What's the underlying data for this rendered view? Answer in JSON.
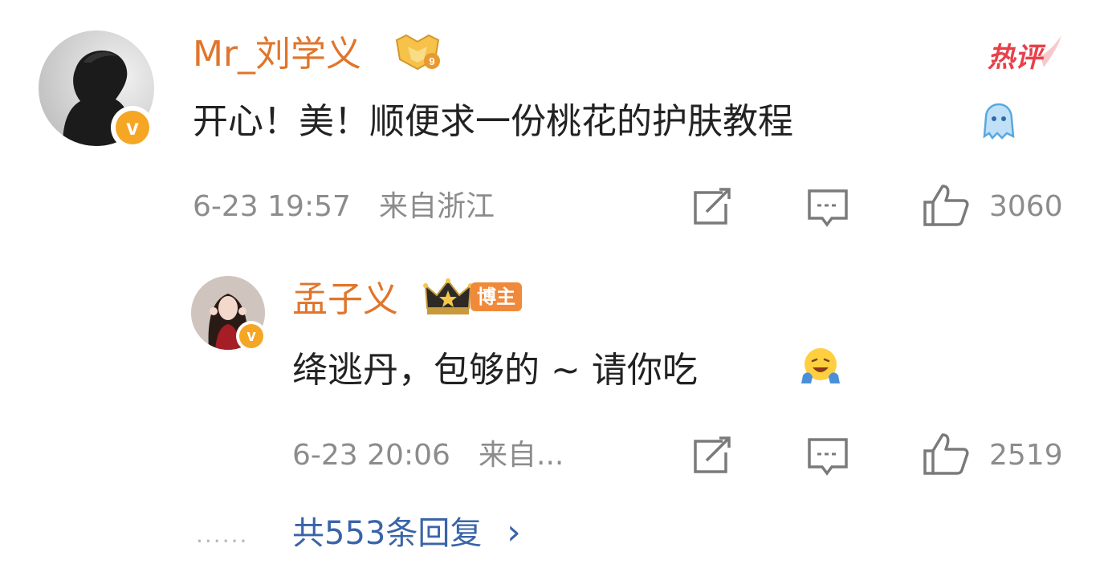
{
  "main_comment": {
    "username": "Mr_刘学义",
    "level_badge_icon": "level-9-badge-icon",
    "hot_tag": "热评",
    "text": "开心！美！顺便求一份桃花的护肤教程",
    "emoji_icon": "blue-ghost-emoji-icon",
    "time": "6-23 19:57",
    "location": "来自浙江",
    "likes": "3060",
    "verified_badge": "v"
  },
  "reply": {
    "username": "孟子义",
    "crown_badge_icon": "crown-badge-icon",
    "blogger_tag": "博主",
    "text": "绛逃丹，包够的 ~ 请你吃",
    "emoji_icon": "laughing-emoji-icon",
    "time": "6-23 20:06",
    "location": "来自...",
    "likes": "2519",
    "verified_badge": "v"
  },
  "footer": {
    "dots": "......",
    "replies_text": "共553条回复",
    "chevron": "›"
  },
  "colors": {
    "username": "#e0752b",
    "link": "#3a64a8",
    "meta": "#8c8c8c",
    "hot": "#e8404a",
    "badge": "#f5a623"
  }
}
